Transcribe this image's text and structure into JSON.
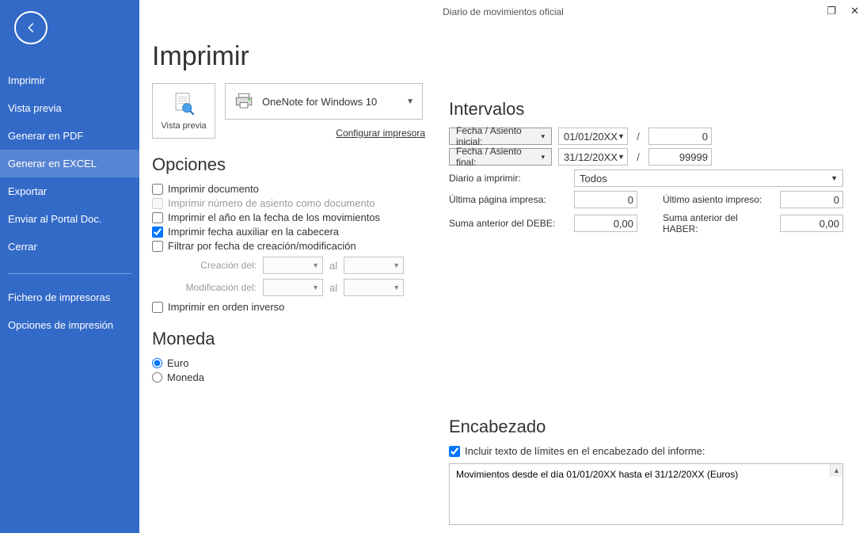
{
  "window": {
    "title": "Diario de movimientos oficial"
  },
  "sidebar": {
    "items": [
      "Imprimir",
      "Vista previa",
      "Generar en PDF",
      "Generar en EXCEL",
      "Exportar",
      "Enviar al Portal Doc.",
      "Cerrar"
    ],
    "items2": [
      "Fichero de impresoras",
      "Opciones de impresión"
    ],
    "selectedIndex": 3
  },
  "page": {
    "title": "Imprimir",
    "preview_label": "Vista previa",
    "printer_name": "OneNote for Windows 10",
    "configure_link": "Configurar impresora"
  },
  "options": {
    "heading": "Opciones",
    "print_doc": "Imprimir documento",
    "print_num": "Imprimir número de asiento como documento",
    "print_year": "Imprimir el año en la fecha de los movimientos",
    "print_auxdate": "Imprimir fecha auxiliar en la cabecera",
    "filter_date": "Filtrar por fecha de creación/modificación",
    "creation": "Creación del:",
    "modification": "Modificación del:",
    "al": "al",
    "reverse": "Imprimir en orden inverso"
  },
  "currency": {
    "heading": "Moneda",
    "euro": "Euro",
    "moneda": "Moneda"
  },
  "intervals": {
    "heading": "Intervalos",
    "initial_btn": "Fecha / Asiento inicial:",
    "final_btn": "Fecha / Asiento final:",
    "initial_date": "01/01/20XX",
    "final_date": "31/12/20XX",
    "initial_entry": "0",
    "final_entry": "99999",
    "diary_label": "Diario a imprimir:",
    "diary_value": "Todos",
    "last_page": "Última página impresa:",
    "last_page_val": "0",
    "last_entry": "Último asiento impreso:",
    "last_entry_val": "0",
    "debe": "Suma anterior del DEBE:",
    "debe_val": "0,00",
    "haber": "Suma anterior del HABER:",
    "haber_val": "0,00"
  },
  "header": {
    "heading": "Encabezado",
    "include": "Incluir texto de límites en el encabezado del informe:",
    "text": "Movimientos desde el día 01/01/20XX hasta el 31/12/20XX (Euros)"
  }
}
